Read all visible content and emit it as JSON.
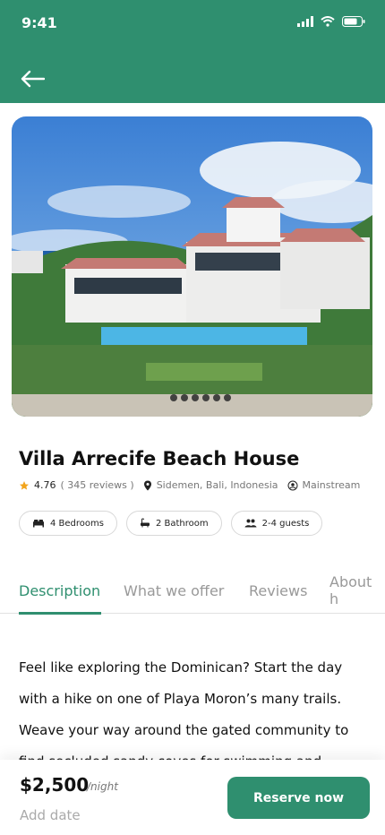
{
  "status": {
    "time": "9:41"
  },
  "property": {
    "title": "Villa Arrecife Beach House",
    "rating": "4.76",
    "reviews": "( 345 reviews )",
    "location": "Sidemen, Bali, Indonesia",
    "category": "Mainstream"
  },
  "chips": {
    "bedrooms": "4 Bedrooms",
    "bathrooms": "2 Bathroom",
    "guests": "2-4 guests"
  },
  "tabs": {
    "description": "Description",
    "offer": "What we offer",
    "reviews": "Reviews",
    "about": "About h"
  },
  "description": "Feel like exploring the Dominican? Start the day with a hike on one of Playa Moron’s many trails. Weave your way around the gated community to find secluded sandy coves for swimming and",
  "booking": {
    "price": "$2,500",
    "per": "/night",
    "add_date": "Add date",
    "reserve": "Reserve now"
  },
  "icons": [
    "back-icon",
    "star-icon",
    "location-icon",
    "user-icon",
    "bed-icon",
    "bath-icon",
    "guests-icon"
  ],
  "colors": {
    "primary": "#2f8f6f"
  }
}
